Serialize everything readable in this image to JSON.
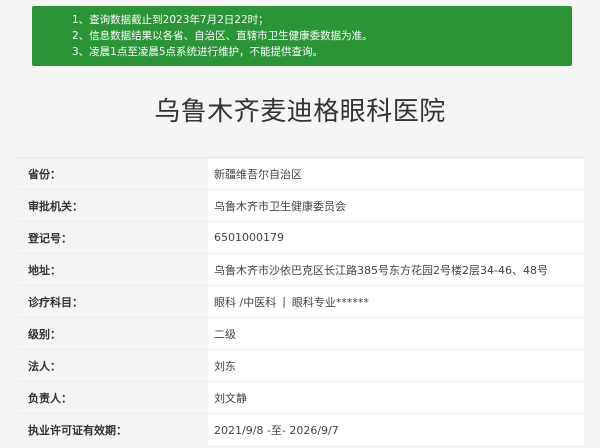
{
  "notice": {
    "lines": [
      "1、查询数据截止到2023年7月2日22时；",
      "2、信息数据结果以各省、自治区、直辖市卫生健康委数据为准。",
      "3、凌晨1点至凌晨5点系统进行维护，不能提供查询。"
    ]
  },
  "hospital": {
    "name": "乌鲁木齐麦迪格眼科医院"
  },
  "info": {
    "rows": [
      {
        "label": "省份：",
        "value": "新疆维吾尔自治区"
      },
      {
        "label": "审批机关：",
        "value": "乌鲁木齐市卫生健康委员会"
      },
      {
        "label": "登记号：",
        "value": "6501000179"
      },
      {
        "label": "地址：",
        "value": "乌鲁木齐市沙依巴克区长江路385号东方花园2号楼2层34-46、48号"
      },
      {
        "label": "诊疗科目：",
        "value_parts": [
          "眼科 /中医科",
          "|",
          "眼科专业******"
        ]
      },
      {
        "label": "级别：",
        "value": "二级"
      },
      {
        "label": "法人：",
        "value": "刘东"
      },
      {
        "label": "负责人：",
        "value": "刘文静"
      },
      {
        "label": "执业许可证有效期：",
        "value": "2021/9/8 -至- 2026/9/7"
      }
    ]
  }
}
